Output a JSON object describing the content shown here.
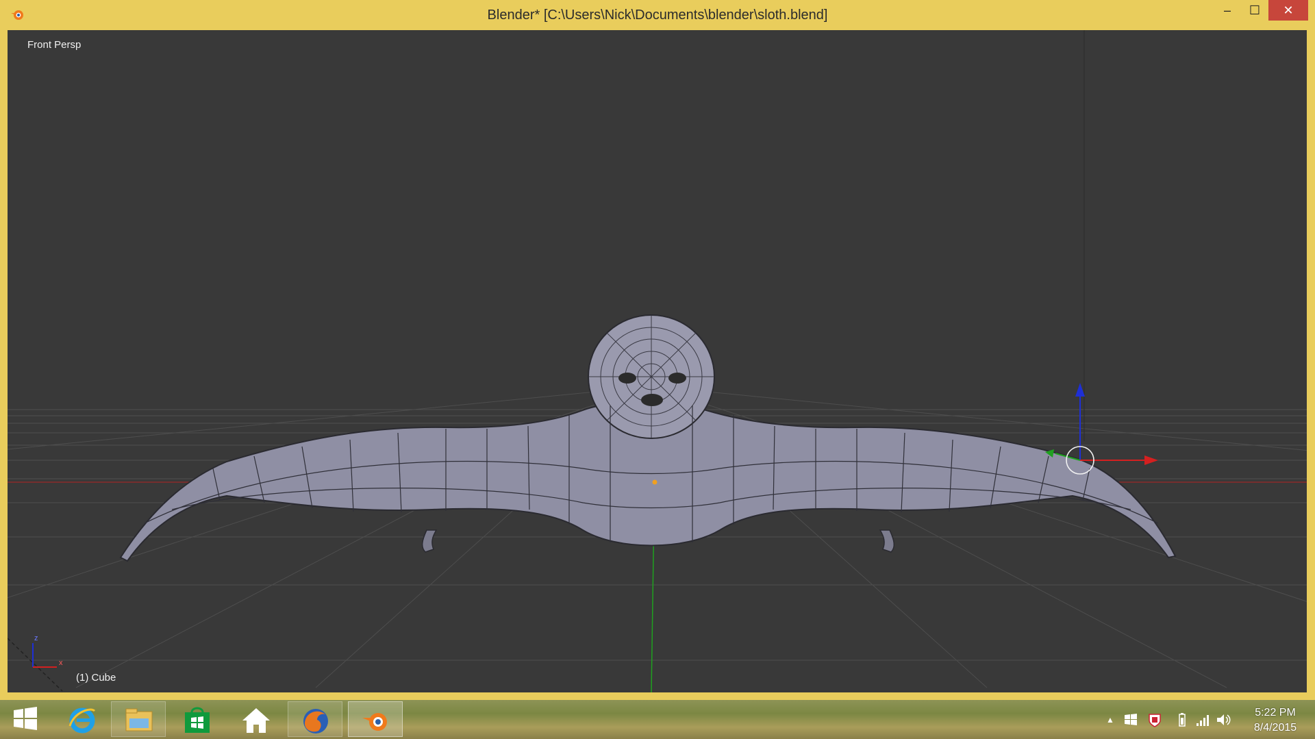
{
  "window": {
    "title": "Blender* [C:\\Users\\Nick\\Documents\\blender\\sloth.blend]",
    "controls": {
      "minimize": "‒",
      "maximize": "☐",
      "close": "✕"
    }
  },
  "viewport": {
    "view_label": "Front Persp",
    "object_label": "(1) Cube",
    "gizmo_axes": {
      "z": "z",
      "x": "x"
    }
  },
  "taskbar": {
    "pinned": [
      {
        "icon": "windows-start-icon"
      },
      {
        "icon": "internet-explorer-icon"
      },
      {
        "icon": "file-explorer-icon"
      },
      {
        "icon": "windows-store-icon"
      },
      {
        "icon": "home-icon"
      },
      {
        "icon": "firefox-icon"
      },
      {
        "icon": "blender-icon"
      }
    ],
    "tray": {
      "show_hidden": "▲",
      "time": "5:22 PM",
      "date": "8/4/2015"
    }
  },
  "colors": {
    "window_frame": "#e9cd5c",
    "viewport_bg": "#393939",
    "axis_x": "#d42020",
    "axis_y": "#1fa11f",
    "axis_z": "#1e2fd6",
    "mesh": "#8f8fa4",
    "close_button": "#c7463b"
  }
}
